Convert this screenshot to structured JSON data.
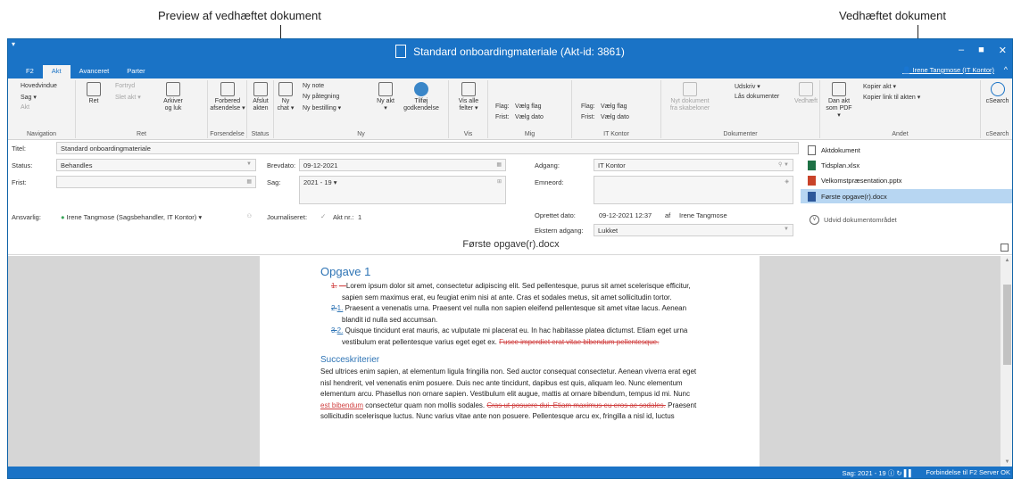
{
  "callouts": {
    "preview": "Preview af vedhæftet dokument",
    "attached": "Vedhæftet dokument"
  },
  "window": {
    "title": "Standard onboardingmateriale (Akt-id: 3861)",
    "minimize": "‒",
    "maximize": "■",
    "close": "✕"
  },
  "tabs": [
    "F2",
    "Akt",
    "Avanceret",
    "Parter"
  ],
  "user": "Irene Tangmose (IT Kontor)",
  "ribbon": {
    "navigation": {
      "label": "Navigation",
      "hovedvindue": "Hovedvindue",
      "sag": "Sag ▾",
      "akt": "Akt"
    },
    "ret": {
      "label": "Ret",
      "ret": "Ret",
      "fortryd": "Fortryd",
      "slet": "Slet akt ▾",
      "arkiver": "Arkiver og luk"
    },
    "forsendelse": {
      "label": "Forsendelse",
      "forbered": "Forbered afsendelse ▾"
    },
    "status": {
      "label": "Status",
      "afslut": "Afslut akten"
    },
    "ny": {
      "label": "Ny",
      "chat": "Ny chat ▾",
      "note": "Ny note",
      "paategning": "Ny påtegning",
      "bestilling": "Ny bestilling ▾",
      "nyakt": "Ny akt ▾",
      "tilfoej": "Tilføj godkendelse"
    },
    "vis": {
      "label": "Vis",
      "visalle": "Vis alle felter ▾"
    },
    "mig": {
      "label": "Mig",
      "flag": "Flag:",
      "flagval": "Vælg flag",
      "frist": "Frist:",
      "fristval": "Vælg dato"
    },
    "itkontor": {
      "label": "IT Kontor",
      "flag": "Flag:",
      "flagval": "Vælg flag",
      "frist": "Frist:",
      "fristval": "Vælg dato"
    },
    "dokumenter": {
      "label": "Dokumenter",
      "nytdok": "Nyt dokument fra skabeloner",
      "udskriv": "Udskriv ▾",
      "laas": "Lås dokumenter",
      "vedhaeft": "Vedhæft"
    },
    "andet": {
      "label": "Andet",
      "pdf": "Dan akt som PDF ▾",
      "kopier": "Kopier akt ▾",
      "kopierlink": "Kopier link til akten ▾"
    },
    "csearch": {
      "label": "cSearch",
      "btn": "cSearch"
    }
  },
  "form": {
    "titel_label": "Titel:",
    "titel": "Standard onboardingmateriale",
    "status_label": "Status:",
    "status": "Behandles",
    "frist_label": "Frist:",
    "frist": "",
    "ansvarlig_label": "Ansvarlig:",
    "ansvarlig": "Irene Tangmose (Sagsbehandler, IT Kontor) ▾",
    "brevdato_label": "Brevdato:",
    "brevdato": "09-12-2021",
    "sag_label": "Sag:",
    "sag": "2021 - 19 ▾",
    "journal_label": "Journaliseret:",
    "aktnr_label": "Akt nr.:",
    "aktnr": "1",
    "adgang_label": "Adgang:",
    "adgang": "IT Kontor",
    "emneord_label": "Emneord:",
    "oprettet_label": "Oprettet dato:",
    "oprettet": "09-12-2021 12:37",
    "af": "af",
    "oprettet_af": "Irene Tangmose",
    "ekstern_label": "Ekstern adgang:",
    "ekstern": "Lukket"
  },
  "attachments": {
    "items": [
      "Aktdokument",
      "Tidsplan.xlsx",
      "Velkomstpræsentation.pptx",
      "Første opgave(r).docx"
    ],
    "expand": "Udvid dokumentområdet"
  },
  "preview": {
    "title": "Første opgave(r).docx",
    "heading1": "Opgave 1",
    "item1_num": "1.",
    "item1": "Lorem ipsum dolor sit amet, consectetur adipiscing elit. Sed pellentesque, purus sit amet scelerisque efficitur, sapien sem maximus erat, eu feugiat enim nisi at ante. Cras et sodales metus, sit amet sollicitudin tortor.",
    "item2_num_old": "2.",
    "item2_num_new": "1.",
    "item2": "Praesent a venenatis urna. Praesent vel nulla non sapien eleifend pellentesque sit amet vitae lacus. Aenean blandit id nulla sed accumsan.",
    "item3_num_old": "3.",
    "item3_num_new": "2.",
    "item3": "Quisque tincidunt erat mauris, ac vulputate mi placerat eu. In hac habitasse platea dictumst. Etiam eget urna vestibulum erat pellentesque varius eget eget ex.",
    "item3_del": "Fusce imperdiet erat vitae bibendum pellentesque.",
    "heading2": "Succeskriterier",
    "p1_a": "Sed ultrices enim sapien, at elementum ligula fringilla non. Sed auctor consequat consectetur. Aenean viverra erat eget nisl hendrerit, vel venenatis enim posuere. Duis nec ante tincidunt, dapibus est quis, aliquam leo. Nunc elementum elementum arcu. Phasellus non ornare sapien. Vestibulum elit augue, mattis at ornare bibendum, tempus id mi. Nunc",
    "p1_ins": "est bibendum",
    "p1_b": "consectetur quam non mollis sodales.",
    "p1_del": "Cras ut posuere dui. Etiam maximus eu eros ac sodales.",
    "p1_c": "Praesent sollicitudin scelerisque luctus. Nunc varius vitae ante non posuere. Pellentesque arcu ex, fringilla a nisl id, luctus"
  },
  "statusbar": {
    "sag": "Sag: 2021 - 19 ⓘ ↻ ▌▌",
    "conn": "Forbindelse til F2 Server OK"
  },
  "colors": {
    "accent": "#1a73c6",
    "selection": "#b7d6f2",
    "heading": "#2e74b5",
    "revision": "#d04040"
  }
}
